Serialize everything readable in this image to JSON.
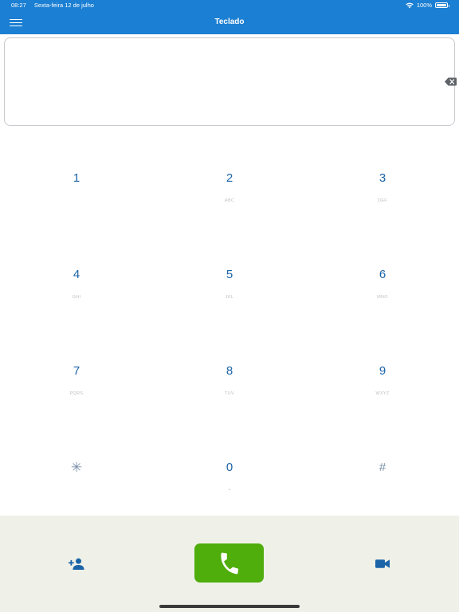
{
  "status_bar": {
    "time": "08:27",
    "date": "Sexta-feira 12 de julho",
    "battery": "100%"
  },
  "header": {
    "title": "Teclado"
  },
  "display": {
    "value": ""
  },
  "keypad": {
    "keys": [
      {
        "digit": "1",
        "letters": ""
      },
      {
        "digit": "2",
        "letters": "ABC"
      },
      {
        "digit": "3",
        "letters": "DEF"
      },
      {
        "digit": "4",
        "letters": "GHI"
      },
      {
        "digit": "5",
        "letters": "JKL"
      },
      {
        "digit": "6",
        "letters": "MNO"
      },
      {
        "digit": "7",
        "letters": "PQRS"
      },
      {
        "digit": "8",
        "letters": "TUV"
      },
      {
        "digit": "9",
        "letters": "WXYZ"
      },
      {
        "digit": "✳",
        "letters": ""
      },
      {
        "digit": "0",
        "letters": "+"
      },
      {
        "digit": "#",
        "letters": ""
      }
    ]
  },
  "icons": {
    "menu": "menu-icon",
    "backspace": "backspace-icon",
    "add_contact": "add-contact-icon",
    "call": "phone-icon",
    "video": "video-camera-icon"
  },
  "colors": {
    "header": "#1b7fd3",
    "digit": "#1b64a8",
    "call_button": "#4fad0c",
    "bottom_bar": "#eff1e8"
  }
}
